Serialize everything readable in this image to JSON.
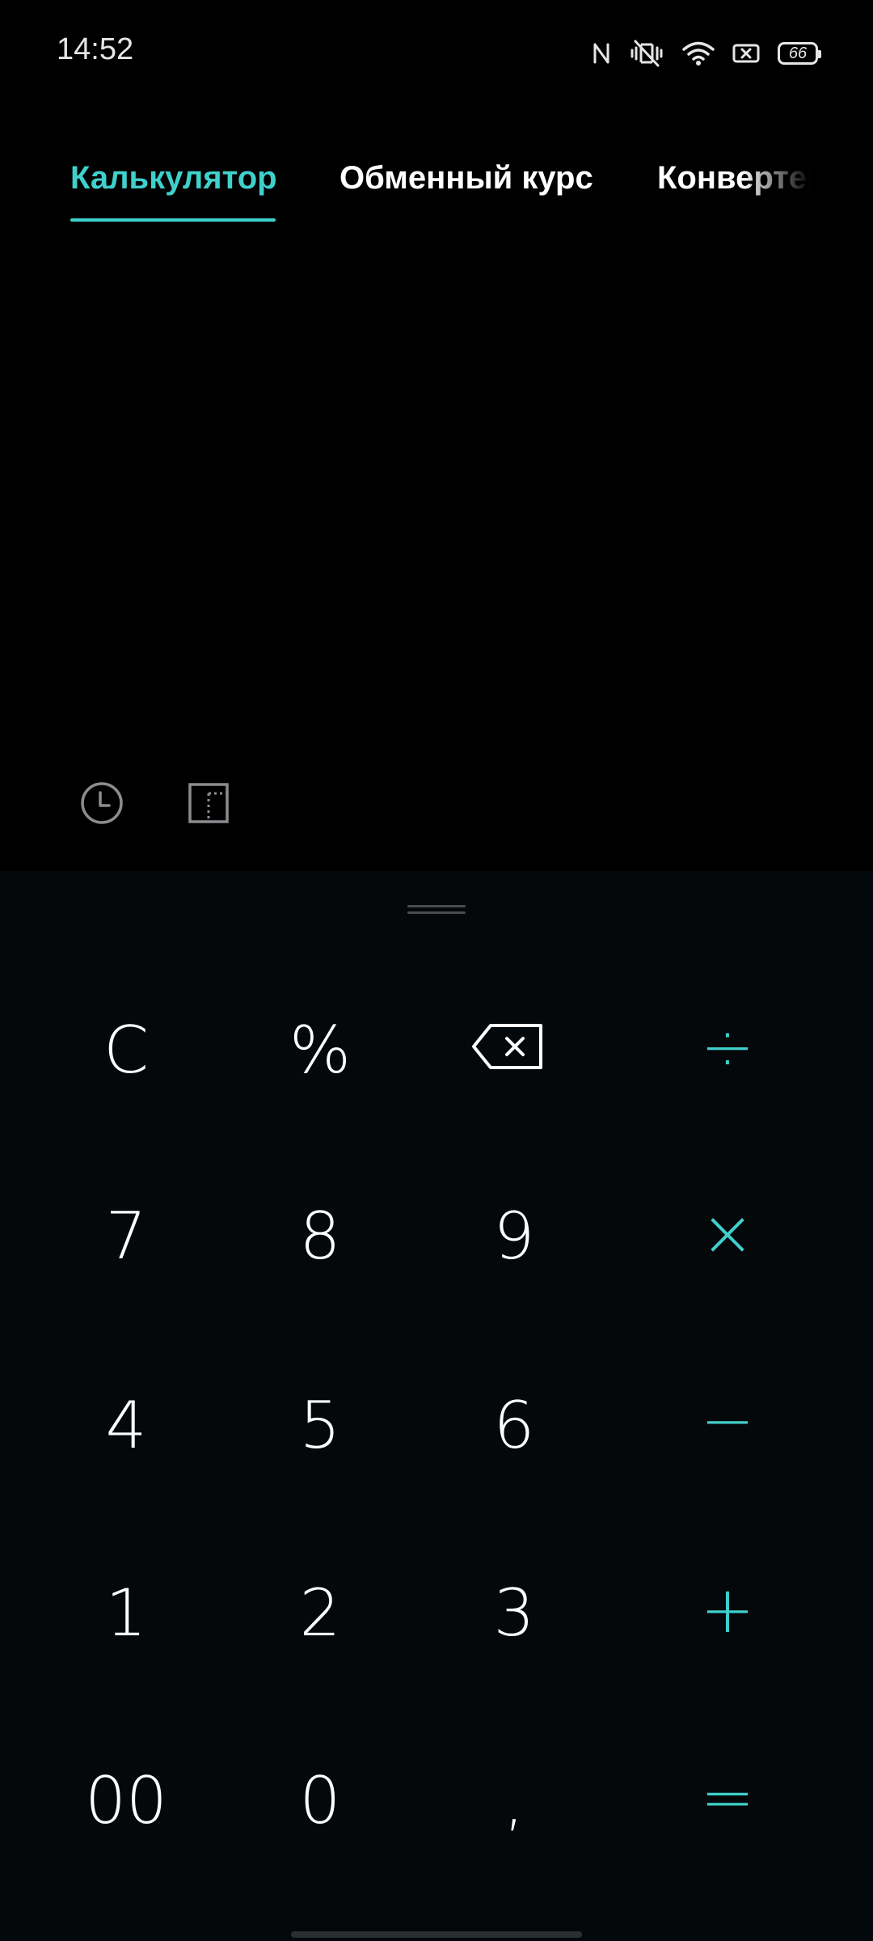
{
  "status_bar": {
    "time": "14:52",
    "icons": [
      "nfc-icon",
      "vibrate-icon",
      "wifi-icon",
      "screen-record-icon",
      "battery-icon"
    ],
    "battery_level": "66"
  },
  "tabs": [
    {
      "label": "Калькулятор",
      "active": true
    },
    {
      "label": "Обменный курс",
      "active": false
    },
    {
      "label": "Конвертер",
      "active": false
    }
  ],
  "tools": {
    "history_icon": "clock-icon",
    "scientific_icon": "scientific-toggle-icon"
  },
  "keypad": {
    "rows": [
      [
        {
          "label": "C",
          "type": "fn"
        },
        {
          "label": "%",
          "type": "fn"
        },
        {
          "label": "",
          "icon": "backspace-icon",
          "type": "fn"
        },
        {
          "label": "÷",
          "type": "op"
        }
      ],
      [
        {
          "label": "7"
        },
        {
          "label": "8"
        },
        {
          "label": "9"
        },
        {
          "label": "×",
          "type": "op"
        }
      ],
      [
        {
          "label": "4"
        },
        {
          "label": "5"
        },
        {
          "label": "6"
        },
        {
          "label": "−",
          "type": "op"
        }
      ],
      [
        {
          "label": "1"
        },
        {
          "label": "2"
        },
        {
          "label": "3"
        },
        {
          "label": "+",
          "type": "op"
        }
      ],
      [
        {
          "label": "00"
        },
        {
          "label": "0"
        },
        {
          "label": ","
        },
        {
          "label": "=",
          "type": "op"
        }
      ]
    ]
  },
  "colors": {
    "accent": "#3fd0cc",
    "background": "#000000",
    "keypad_background": "#05080a",
    "text": "#ffffff"
  }
}
